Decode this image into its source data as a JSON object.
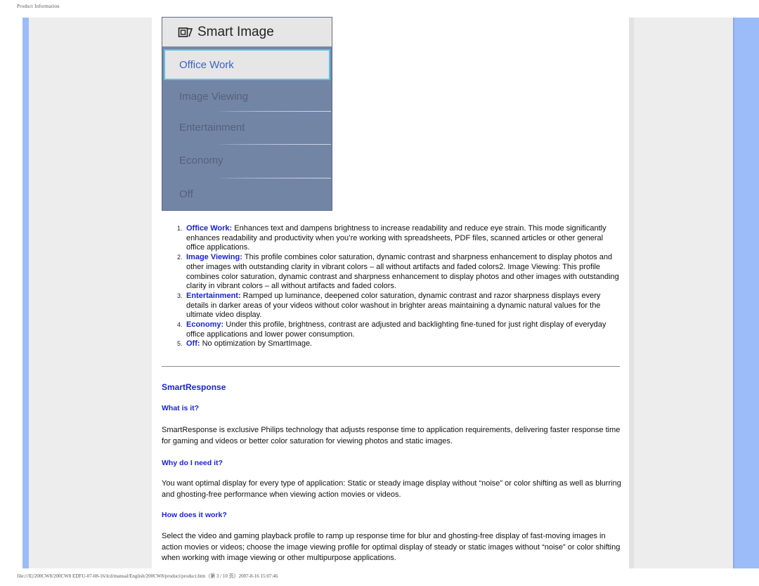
{
  "header": {
    "title": "Product Information"
  },
  "osd_menu": {
    "title": "Smart Image",
    "icon": "smart-image-icon",
    "selected": "Office Work",
    "items": [
      "Image Viewing",
      "Entertainment",
      "Economy",
      "Off"
    ]
  },
  "profiles": [
    {
      "num": "1.",
      "name": "Office Work:",
      "text": " Enhances text and dampens brightness to increase readability and reduce eye strain. This mode significantly enhances readability and productivity when you’re working with spreadsheets, PDF files, scanned articles or other general office applications."
    },
    {
      "num": "2.",
      "name": "Image Viewing:",
      "text": " This profile combines color saturation, dynamic contrast and sharpness enhancement to display photos and other images with outstanding clarity in vibrant colors – all without artifacts and faded colors2. Image Viewing: This profile combines color saturation, dynamic contrast and sharpness enhancement to display photos and other images with outstanding clarity in vibrant colors – all without artifacts and faded colors."
    },
    {
      "num": "3.",
      "name": "Entertainment:",
      "text": " Ramped up luminance, deepened color saturation, dynamic contrast and razor sharpness displays every details in darker areas of your videos without color washout in brighter areas maintaining a dynamic natural values for the ultimate video display."
    },
    {
      "num": "4.",
      "name": "Economy:",
      "text": " Under this profile, brightness, contrast are adjusted and backlighting fine-tuned for just right display of everyday office applications and lower power consumption."
    },
    {
      "num": "5.",
      "name": "Off:",
      "text": " No optimization by SmartImage."
    }
  ],
  "smartresponse": {
    "title": "SmartResponse",
    "what_q": "What is it?",
    "what_a": "SmartResponse is exclusive Philips technology that adjusts response time to application requirements, delivering faster response time for gaming and videos or better color saturation for viewing photos and static images.",
    "why_q": "Why do I need it?",
    "why_a": "You want optimal display for every type of application: Static or steady image display without “noise” or color shifting as well as blurring and ghosting-free performance when viewing action movies or videos.",
    "how_q": "How does it work?",
    "how_a": "Select the video and gaming playback profile to ramp up response time for blur and ghosting-free display of fast-moving images in action movies or videos; choose the image viewing profile for optimal display of steady or static images without “noise” or color shifting when working with image viewing or other multipurpose applications."
  },
  "footer": {
    "text": "file:///E|/200CW8/200CW8 EDFU-07-08-16/lcd/manual/English/200CW8/product/product.htm（第 3 / 10 页）2007-8-16 15:07:46"
  },
  "colors": {
    "accent": "#1a24d6",
    "side_bar": "#9bbcf8",
    "osd_bg": "#7285a5",
    "osd_highlight": "#63bfe0"
  }
}
